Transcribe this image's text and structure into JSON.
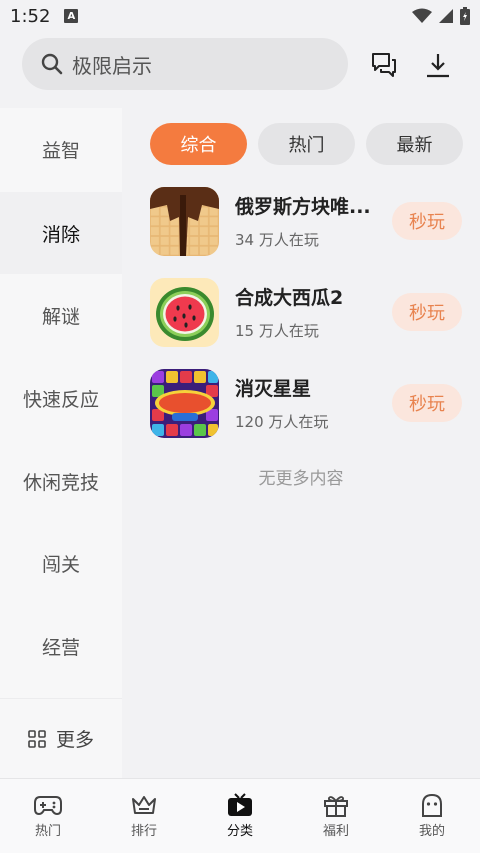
{
  "status": {
    "time": "1:52",
    "badge": "A"
  },
  "search": {
    "text": "极限启示"
  },
  "sidebar": {
    "items": [
      "益智",
      "消除",
      "解谜",
      "快速反应",
      "休闲竞技",
      "闯关",
      "经营"
    ],
    "active_index": 1,
    "more_label": "更多"
  },
  "chips": [
    "综合",
    "热门",
    "最新"
  ],
  "active_chip": 0,
  "games": [
    {
      "title": "俄罗斯方块唯...",
      "players": "34 万人在玩",
      "play": "秒玩",
      "icon": "wood-block-puzzle-icon"
    },
    {
      "title": "合成大西瓜2",
      "players": "15 万人在玩",
      "play": "秒玩",
      "icon": "watermelon-icon"
    },
    {
      "title": "消灭星星",
      "players": "120 万人在玩",
      "play": "秒玩",
      "icon": "pop-star-icon"
    }
  ],
  "no_more": "无更多内容",
  "tabs": [
    {
      "label": "热门",
      "icon": "gamepad-icon"
    },
    {
      "label": "排行",
      "icon": "crown-icon"
    },
    {
      "label": "分类",
      "icon": "tv-play-icon"
    },
    {
      "label": "福利",
      "icon": "gift-icon"
    },
    {
      "label": "我的",
      "icon": "ghost-icon"
    }
  ],
  "active_tab": 2,
  "colors": {
    "accent": "#f47b3f",
    "play_bg": "#fbe6dd",
    "play_text": "#e8834f"
  }
}
